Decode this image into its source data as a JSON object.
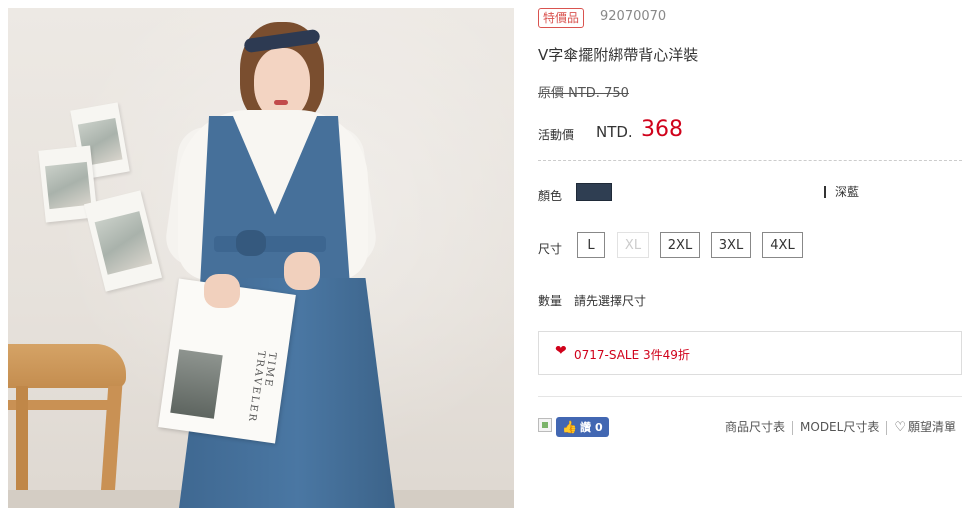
{
  "product": {
    "badge": "特價品",
    "sku": "92070070",
    "title": "V字傘擺附綁帶背心洋裝",
    "original_price": "原價 NTD. 750",
    "sale_label": "活動價",
    "sale_currency": "NTD.",
    "sale_price": "368"
  },
  "photo": {
    "magazine_text": "TIME TRAVELER"
  },
  "options": {
    "color_label": "顏色",
    "color_swatch_hex": "#2f3e52",
    "color_name": "深藍",
    "size_label": "尺寸",
    "sizes": [
      {
        "label": "L",
        "available": true
      },
      {
        "label": "XL",
        "available": false
      },
      {
        "label": "2XL",
        "available": true
      },
      {
        "label": "3XL",
        "available": true
      },
      {
        "label": "4XL",
        "available": true
      }
    ],
    "qty_label": "數量",
    "qty_note": "請先選擇尺寸"
  },
  "promo": {
    "icon": "heart-icon",
    "text": "0717-SALE 3件49折"
  },
  "social": {
    "like_label": "讚",
    "like_count": "0"
  },
  "links": {
    "size_chart": "商品尺寸表",
    "model_chart": "MODEL尺寸表",
    "wishlist": "願望清單"
  },
  "colors": {
    "accent_red": "#d0021b",
    "facebook_blue": "#4267b2"
  }
}
